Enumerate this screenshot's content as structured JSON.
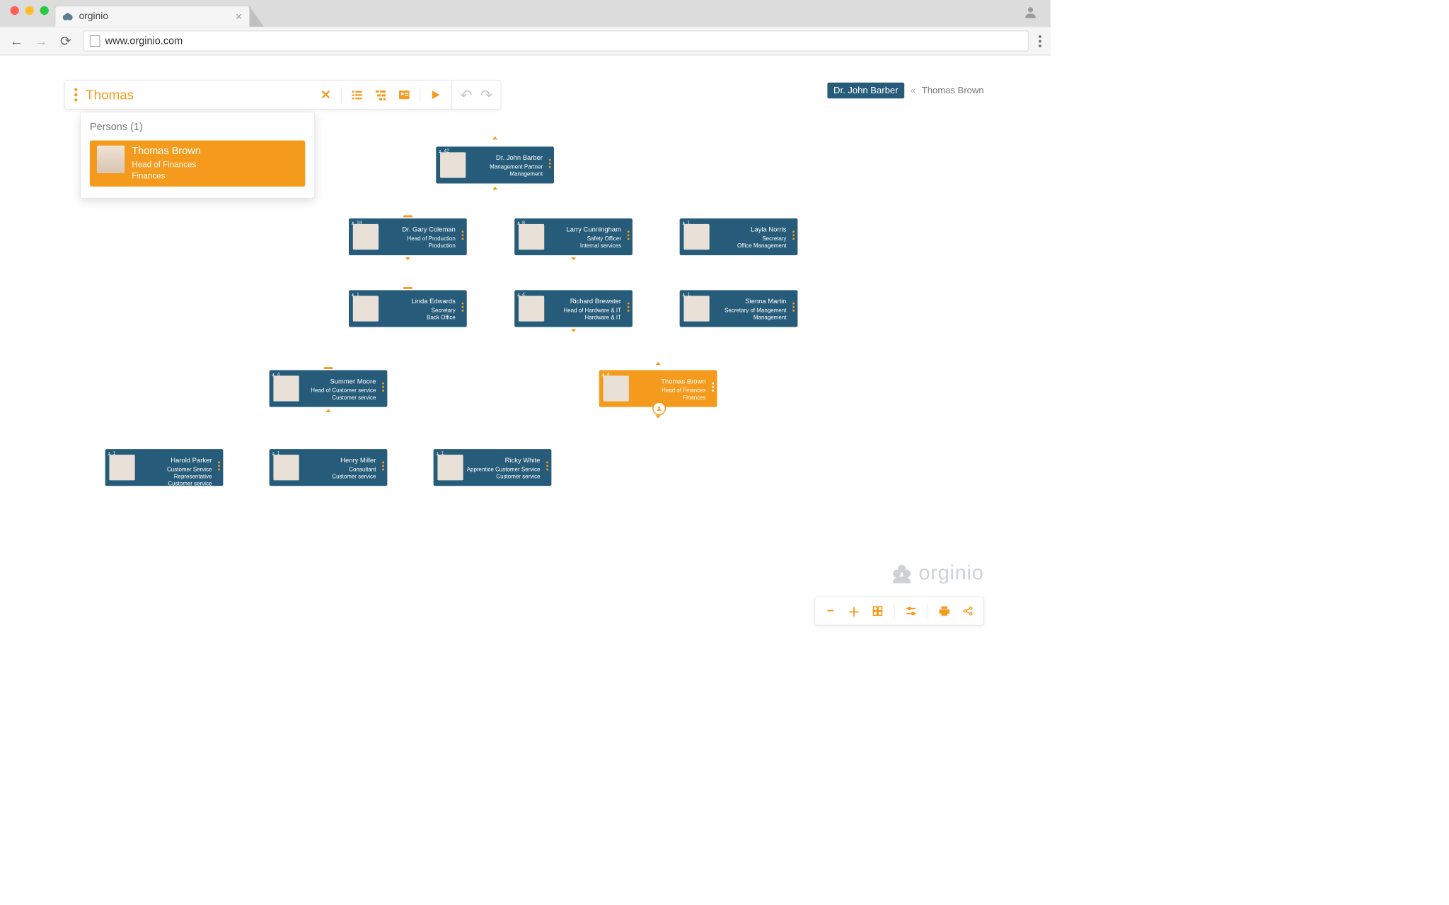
{
  "browser": {
    "tab_title": "orginio",
    "url": "www.orginio.com"
  },
  "toolbar": {
    "search_value": "Thomas"
  },
  "breadcrumb": {
    "root": "Dr. John Barber",
    "current": "Thomas Brown"
  },
  "search_results": {
    "header": "Persons (1)",
    "items": [
      {
        "name": "Thomas Brown",
        "title": "Head of Finances",
        "dept": "Finances"
      }
    ]
  },
  "nodes": {
    "barber": {
      "count": "42",
      "name": "Dr. John Barber",
      "title": "Management Partner",
      "dept": "Management"
    },
    "coleman": {
      "count": "18",
      "name": "Dr. Gary Coleman",
      "title": "Head of Production",
      "dept": "Production"
    },
    "cunningham": {
      "count": "8",
      "name": "Larry Cunningham",
      "title": "Safety Officer",
      "dept": "Internal services"
    },
    "norris": {
      "count": "1",
      "name": "Layla Norris",
      "title": "Secretary",
      "dept": "Office Management"
    },
    "edwards": {
      "count": "1",
      "name": "Linda Edwards",
      "title": "Secretary",
      "dept": "Back Office"
    },
    "brewster": {
      "count": "4",
      "name": "Richard Brewster",
      "title": "Head of Hardware & IT",
      "dept": "Hardware & IT"
    },
    "martin": {
      "count": "1",
      "name": "Sienna Martin",
      "title": "Secretary of Mangement",
      "dept": "Management"
    },
    "moore": {
      "count": "4",
      "name": "Summer Moore",
      "title": "Head of Customer service",
      "dept": "Customer service"
    },
    "brown": {
      "count": "4",
      "name": "Thomas Brown",
      "title": "Head of Finances",
      "dept": "Finances"
    },
    "parker": {
      "count": "1",
      "name": "Harold Parker",
      "title": "Customer Service Representative",
      "dept": "Customer service"
    },
    "miller": {
      "count": "1",
      "name": "Henry Miller",
      "title": "Consultant",
      "dept": "Customer service"
    },
    "white": {
      "count": "1",
      "name": "Ricky White",
      "title": "Apprentice Customer Service",
      "dept": "Customer service"
    }
  },
  "brand": "orginio",
  "colors": {
    "teal": "#265b79",
    "orange": "#f49b1d"
  }
}
